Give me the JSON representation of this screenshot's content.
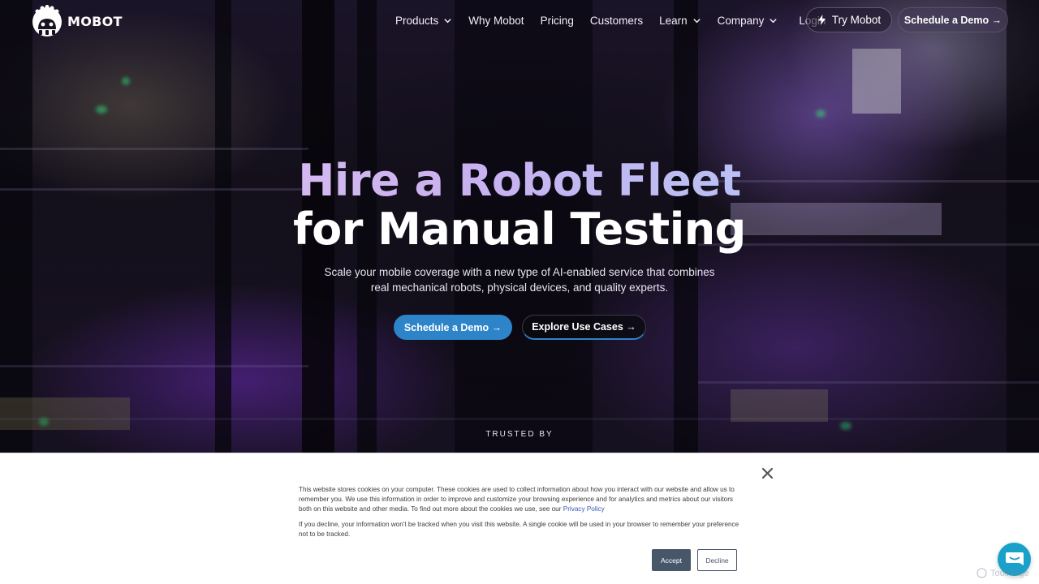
{
  "brand": {
    "name": "MOBOT"
  },
  "nav": {
    "items": [
      {
        "label": "Products",
        "has_dropdown": true
      },
      {
        "label": "Why Mobot",
        "has_dropdown": false
      },
      {
        "label": "Pricing",
        "has_dropdown": false
      },
      {
        "label": "Customers",
        "has_dropdown": false
      },
      {
        "label": "Learn",
        "has_dropdown": true
      },
      {
        "label": "Company",
        "has_dropdown": true
      },
      {
        "label": "Login",
        "has_dropdown": false
      }
    ],
    "try_label": "Try Mobot",
    "demo_label": "Schedule a Demo →"
  },
  "hero": {
    "title_line1": "Hire a Robot Fleet",
    "title_line2": "for Manual Testing",
    "subtitle_line1": "Scale your mobile coverage with a new type of AI-enabled service that combines",
    "subtitle_line2": "real mechanical robots, physical devices, and quality experts.",
    "primary_cta": "Schedule a Demo →",
    "secondary_cta": "Explore Use Cases →",
    "trusted_by": "TRUSTED BY"
  },
  "cookie_banner": {
    "text1": "This website stores cookies on your computer. These cookies are used to collect information about how you interact with our website and allow us to remember you. We use this information in order to improve and customize your browsing experience and for analytics and metrics about our visitors both on this website and other media. To find out more about the cookies we use, see our",
    "privacy_link": "Privacy Policy",
    "text2": "If you decline, your information won't be tracked when you visit this website. A single cookie will be used in your browser to remember your preference not to be tracked.",
    "accept_label": "Accept",
    "decline_label": "Decline"
  },
  "watermark": {
    "label": "ToolMage"
  },
  "colors": {
    "primary_blue": "#2e84c9",
    "accept_bg": "#48566a",
    "chat_teal": "#1aa1c9",
    "link_blue": "#3458b8"
  },
  "icons": {
    "logo": "robot-logo-icon",
    "dropdown": "chevron-down-icon",
    "try": "bolt-icon",
    "close": "close-icon",
    "chat": "chat-bubble-icon"
  }
}
